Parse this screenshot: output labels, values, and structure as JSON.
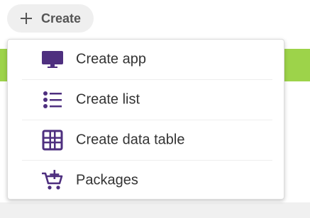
{
  "header": {
    "create_label": "Create"
  },
  "menu": {
    "items": [
      {
        "label": "Create app",
        "icon": "monitor-icon"
      },
      {
        "label": "Create list",
        "icon": "list-icon"
      },
      {
        "label": "Create data table",
        "icon": "table-icon"
      },
      {
        "label": "Packages",
        "icon": "cart-plus-icon"
      }
    ]
  },
  "colors": {
    "accent_purple": "#4e2f7f",
    "banner_green": "#9dd34a",
    "button_bg": "#efefef",
    "text": "#333333"
  }
}
